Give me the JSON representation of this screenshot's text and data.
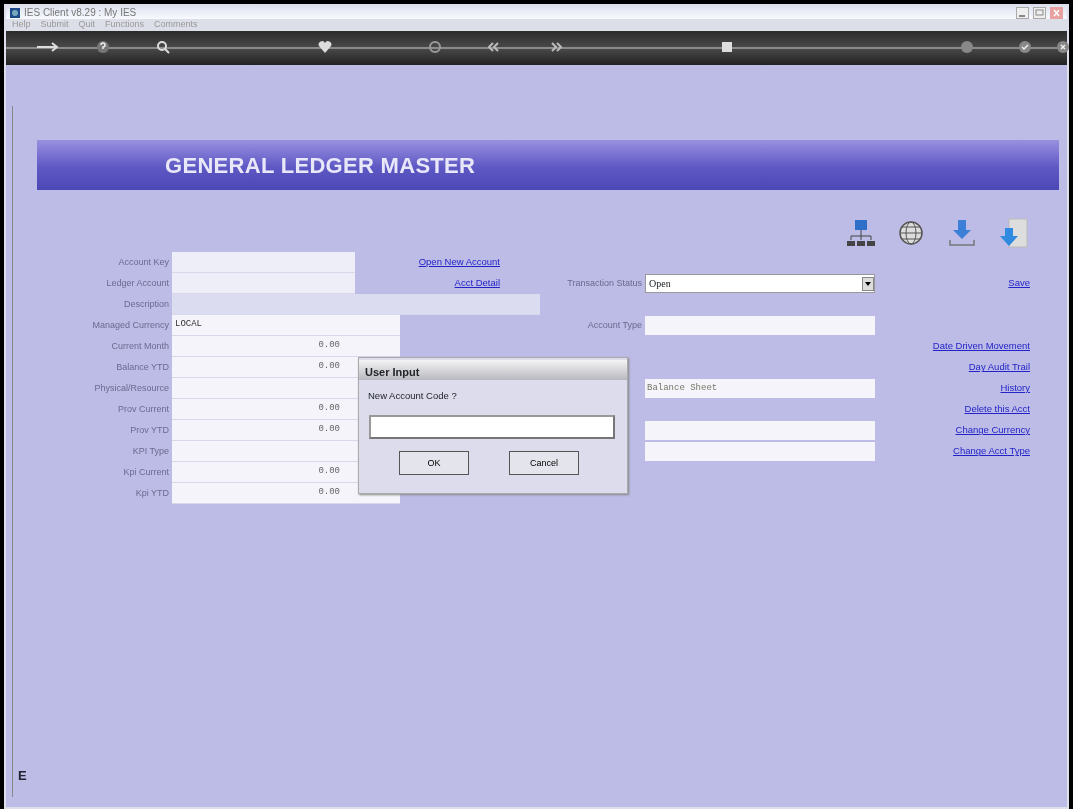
{
  "window": {
    "title": "IES Client v8.29 : My IES"
  },
  "menu": [
    "Help",
    "Submit",
    "Quit",
    "Functions",
    "Comments"
  ],
  "header": {
    "title": "GENERAL LEDGER MASTER"
  },
  "fields": [
    {
      "label": "Account Key",
      "kind": "short"
    },
    {
      "label": "Ledger Account",
      "kind": "short"
    },
    {
      "label": "Description",
      "kind": "wide"
    },
    {
      "label": "Managed Currency",
      "kind": "text",
      "value": "LOCAL"
    },
    {
      "label": "Current Month",
      "kind": "amount",
      "value": "0.00"
    },
    {
      "label": "Balance YTD",
      "kind": "amount",
      "value": "0.00"
    },
    {
      "label": "Physical/Resource",
      "kind": "text"
    },
    {
      "label": "Prov Current",
      "kind": "amount",
      "value": "0.00"
    },
    {
      "label": "Prov YTD",
      "kind": "amount",
      "value": "0.00"
    },
    {
      "label": "KPI Type",
      "kind": "text"
    },
    {
      "label": "Kpi Current",
      "kind": "amount",
      "value": "0.00"
    },
    {
      "label": "Kpi YTD",
      "kind": "amount",
      "value": "0.00"
    }
  ],
  "record_links": [
    "Open New Account",
    "Acct Detail"
  ],
  "transaction_status": {
    "label": "Transaction Status",
    "value": "Open"
  },
  "account_type": {
    "label": "Account Type"
  },
  "side_fields": [
    {
      "kind": "text",
      "value": "Balance Sheet"
    },
    {
      "kind": "text"
    },
    {
      "kind": "text"
    }
  ],
  "actions": [
    "Save",
    "Date Driven Movement",
    "Day Audit Trail",
    "History",
    "Delete this Acct",
    "Change Currency",
    "Change Acct Type"
  ],
  "dialog": {
    "title": "User Input",
    "prompt": "New Account Code ?",
    "buttons": [
      "OK",
      "Cancel"
    ]
  },
  "side_marker": "E"
}
